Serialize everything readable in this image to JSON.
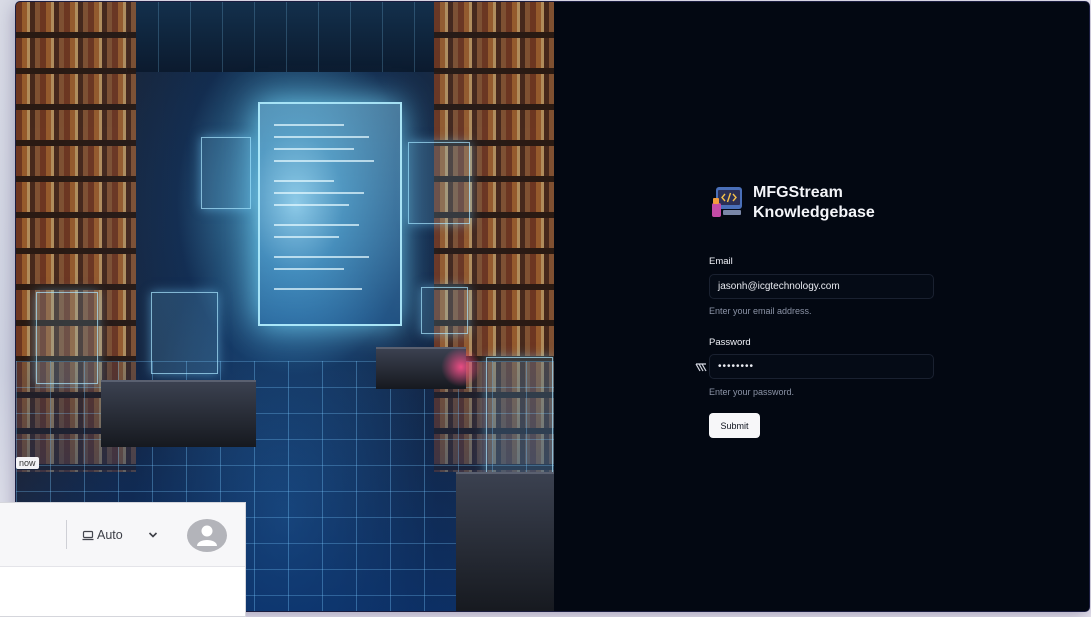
{
  "hero": {
    "overlay_tag": "now"
  },
  "brand": {
    "line1": "MFGStream",
    "line2": "Knowledgebase"
  },
  "login": {
    "email_label": "Email",
    "email_value": "jasonh@icgtechnology.com",
    "email_helper": "Enter your email address.",
    "password_label": "Password",
    "password_value": "••••••••",
    "password_helper": "Enter your password.",
    "submit_label": "Submit"
  },
  "toolbar": {
    "theme_label": "Auto"
  },
  "colors": {
    "app_bg": "#030812",
    "brand_text": "#f4f5f9",
    "button_bg": "#f7f7f9"
  },
  "icons": [
    "brand-logo-icon",
    "password-visibility-icon",
    "monitor-icon",
    "chevron-down-icon",
    "avatar-icon"
  ]
}
